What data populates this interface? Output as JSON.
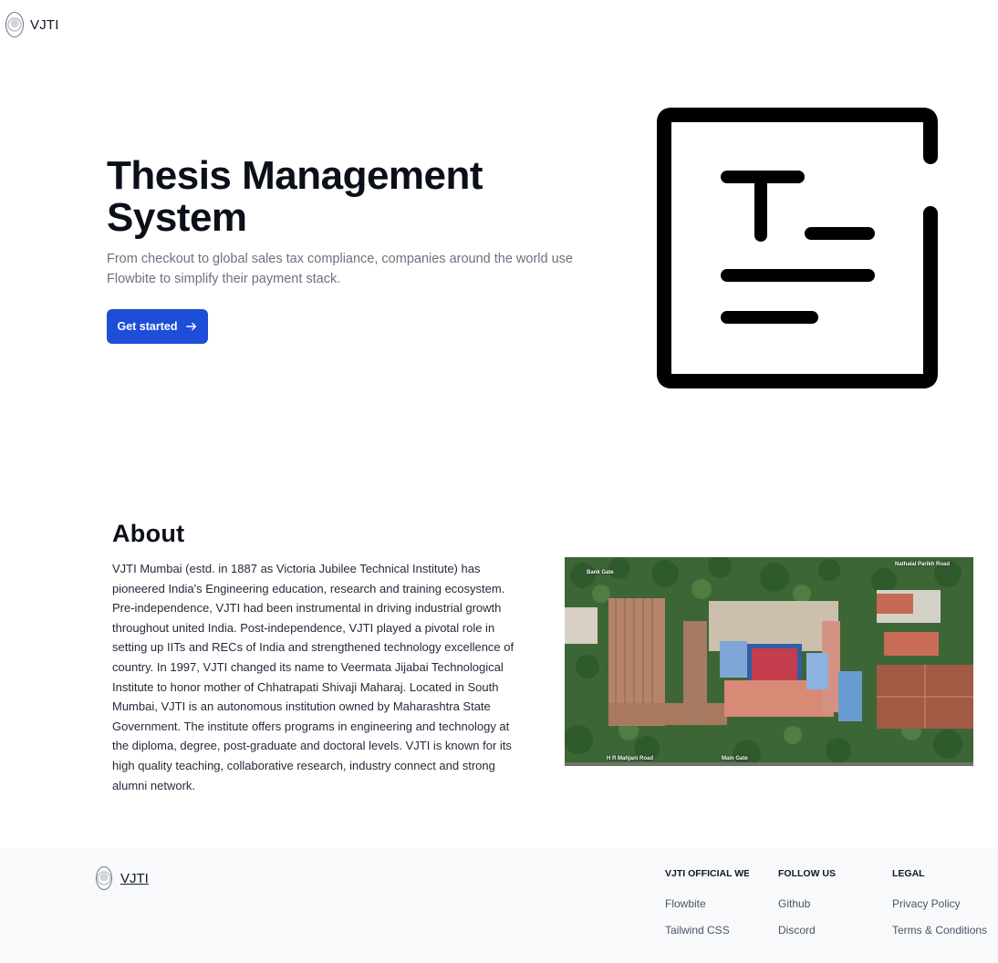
{
  "nav": {
    "brand": "VJTI"
  },
  "hero": {
    "title": "Thesis Management System",
    "subtitle": "From checkout to global sales tax compliance, companies around the world use Flowbite to simplify their payment stack.",
    "cta_label": "Get started",
    "cta_icon": "arrow-right-icon",
    "logo_icon": "thesis-logo-icon"
  },
  "about": {
    "title": "About",
    "body": "VJTI Mumbai (estd. in 1887 as Victoria Jubilee Technical Institute) has pioneered India's Engineering education, research and training ecosystem. Pre-independence, VJTI had been instrumental in driving industrial growth throughout united India. Post-independence, VJTI played a pivotal role in setting up IITs and RECs of India and strengthened technology excellence of country. In 1997, VJTI changed its name to Veermata Jijabai Technological Institute to honor mother of Chhatrapati Shivaji Maharaj. Located in South Mumbai, VJTI is an autonomous institution owned by Maharashtra State Government. The institute offers programs in engineering and technology at the diploma, degree, post-graduate and doctoral levels. VJTI is known for its high quality teaching, collaborative research, industry connect and strong alumni network.",
    "map_labels": {
      "bank_gate": "Bank Gate",
      "nathalal_road": "Nathalal Parikh Road",
      "hr_road": "H R Mahjani Road",
      "main_gate": "Main Gate"
    }
  },
  "footer": {
    "brand": "VJTI",
    "columns": [
      {
        "heading": "VJTI OFFICIAL WEBSITE",
        "links": [
          "Flowbite",
          "Tailwind CSS"
        ]
      },
      {
        "heading": "FOLLOW US",
        "links": [
          "Github",
          "Discord"
        ]
      },
      {
        "heading": "LEGAL",
        "links": [
          "Privacy Policy",
          "Terms & Conditions"
        ]
      }
    ]
  },
  "colors": {
    "primary": "#1d4ed8",
    "heading": "#0b0f19",
    "muted": "#6b7280",
    "footer_bg": "#f8f9fb"
  }
}
